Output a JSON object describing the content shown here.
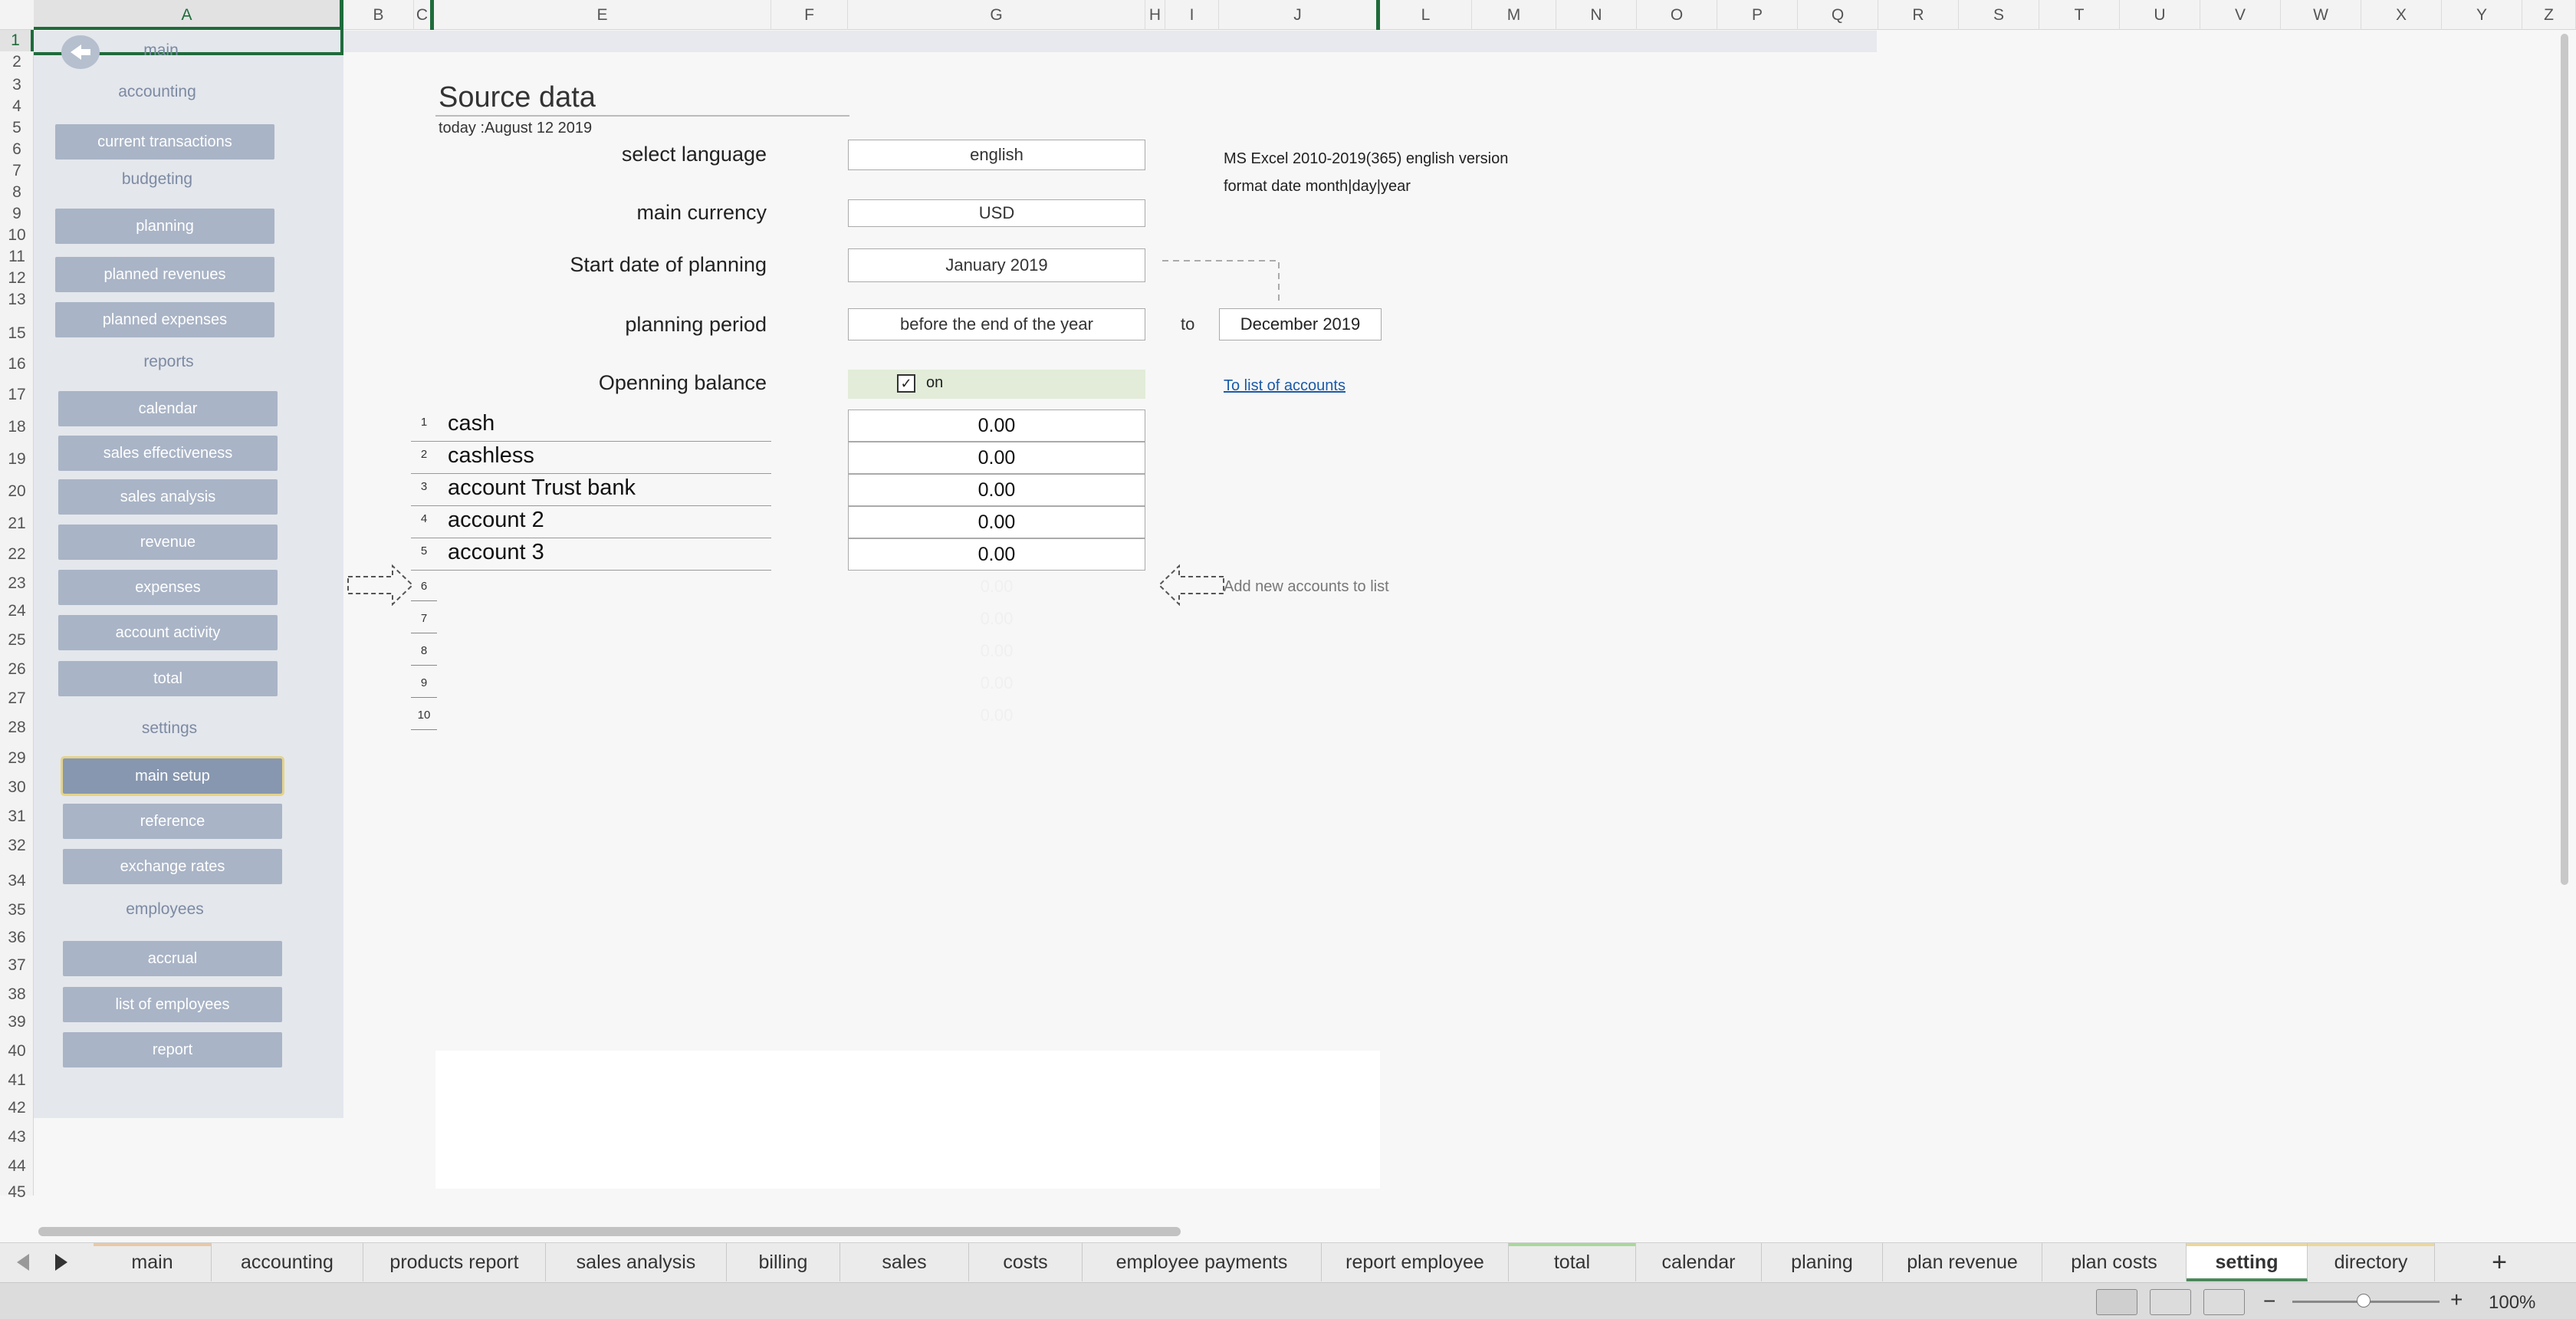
{
  "columns": [
    "A",
    "B",
    "C",
    "E",
    "F",
    "G",
    "H",
    "I",
    "J",
    "L",
    "M",
    "N",
    "O",
    "P",
    "Q",
    "R",
    "S",
    "T",
    "U",
    "V",
    "W",
    "X",
    "Y",
    "Z"
  ],
  "rows": [
    "1",
    "2",
    "3",
    "4",
    "5",
    "6",
    "7",
    "8",
    "9",
    "10",
    "11",
    "12",
    "13",
    "15",
    "16",
    "17",
    "18",
    "19",
    "20",
    "21",
    "22",
    "23",
    "24",
    "25",
    "26",
    "27",
    "28",
    "29",
    "30",
    "31",
    "32",
    "34",
    "35",
    "36",
    "37",
    "38",
    "39",
    "40",
    "41",
    "42",
    "43",
    "44",
    "45"
  ],
  "nav": {
    "main": "main",
    "accounting": "accounting",
    "current_transactions": "current transactions",
    "budgeting": "budgeting",
    "planning": "planning",
    "planned_revenues": "planned revenues",
    "planned_expenses": "planned expenses",
    "reports": "reports",
    "calendar": "calendar",
    "sales_effectiveness": "sales effectiveness",
    "sales_analysis": "sales analysis",
    "revenue": "revenue",
    "expenses": "expenses",
    "account_activity": "account activity",
    "total": "total",
    "settings": "settings",
    "main_setup": "main setup",
    "reference": "reference",
    "exchange_rates": "exchange rates",
    "employees": "employees",
    "accrual": "accrual",
    "list_of_employees": "list of employees",
    "report": "report"
  },
  "page": {
    "title": "Source data",
    "today": "today :August 12 2019",
    "select_language_label": "select language",
    "language_value": "english",
    "main_currency_label": "main currency",
    "currency_value": "USD",
    "start_date_label": "Start date of planning",
    "start_date_value": "January 2019",
    "planning_period_label": "planning period",
    "planning_period_value": "before the end of the year",
    "to_label": "to",
    "end_date_value": "December 2019",
    "opening_balance_label": "Openning balance",
    "opening_checkbox_label": "on",
    "version_note": "MS Excel 2010-2019(365) english version",
    "date_format_note": "format date month|day|year",
    "to_list_link": "To list of accounts",
    "add_new_accounts": "Add new accounts to list"
  },
  "accounts": [
    {
      "num": "1",
      "name": "cash",
      "value": "0.00"
    },
    {
      "num": "2",
      "name": "cashless",
      "value": "0.00"
    },
    {
      "num": "3",
      "name": "account Trust bank",
      "value": "0.00"
    },
    {
      "num": "4",
      "name": "account 2",
      "value": "0.00"
    },
    {
      "num": "5",
      "name": "account 3",
      "value": "0.00"
    }
  ],
  "ghost_accounts": [
    {
      "num": "6",
      "value": "0.00"
    },
    {
      "num": "7",
      "value": "0.00"
    },
    {
      "num": "8",
      "value": "0.00"
    },
    {
      "num": "9",
      "value": "0.00"
    },
    {
      "num": "10",
      "value": "0.00"
    }
  ],
  "tabs": [
    "main",
    "accounting",
    "products report",
    "sales analysis",
    "billing",
    "sales",
    "costs",
    "employee payments",
    "report employee",
    "total",
    "calendar",
    "planing",
    "plan revenue",
    "plan costs",
    "setting",
    "directory"
  ],
  "active_tab": "setting",
  "new_sheet": "+",
  "zoom": "100%",
  "colors": {
    "nav_bg": "#e4e7ec",
    "nav_btn": "#a9b4c6",
    "nav_head": "#7c8aa3",
    "excel_green": "#1e6b3a",
    "link": "#1a5aa8"
  }
}
